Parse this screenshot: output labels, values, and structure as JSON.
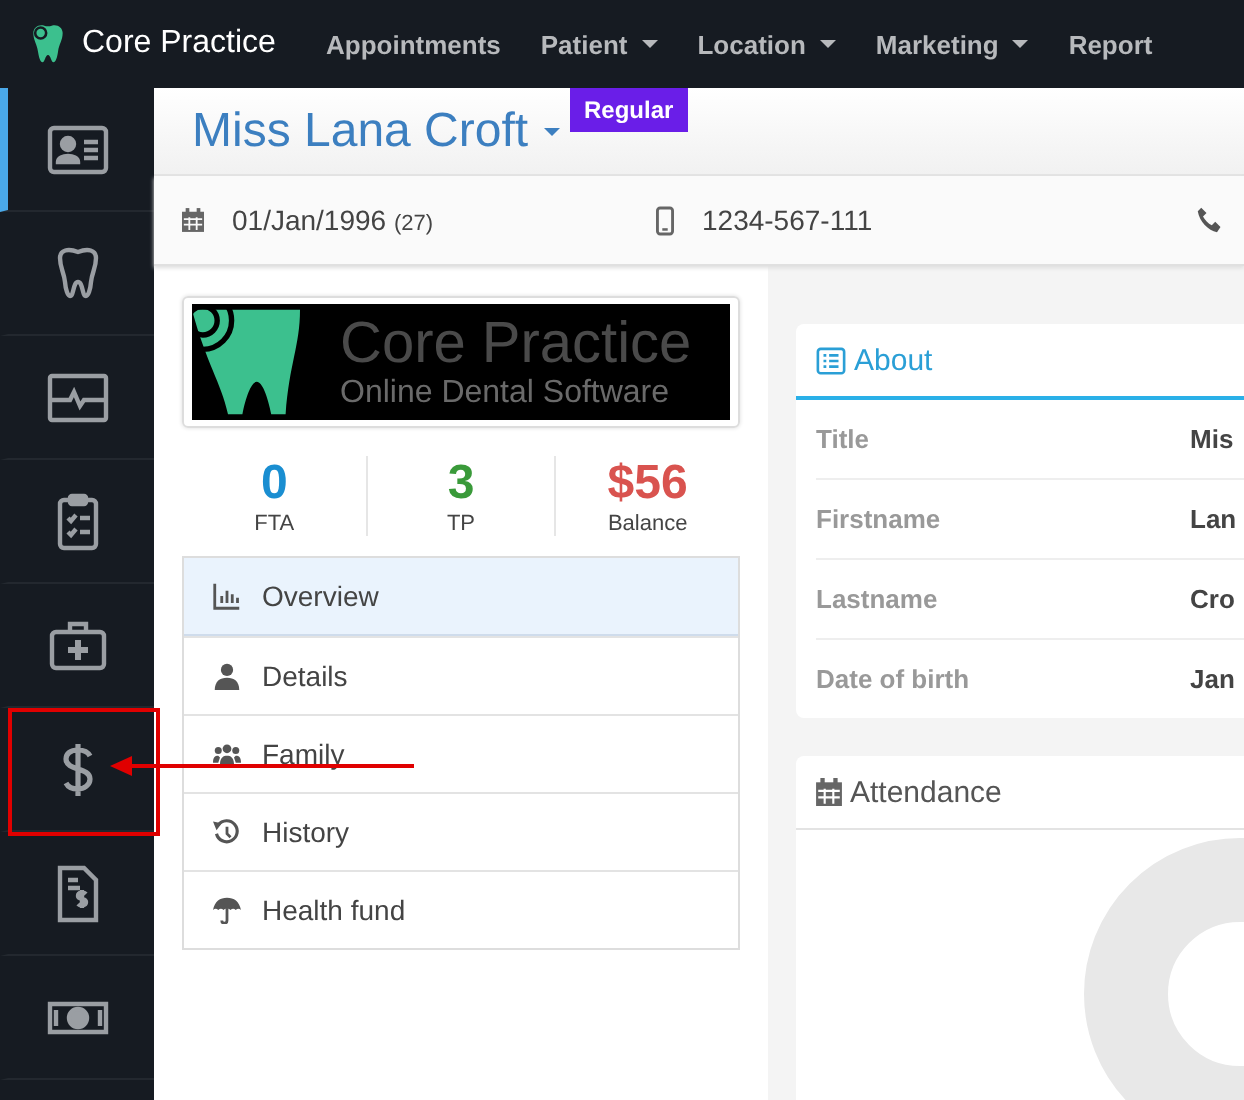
{
  "brand": {
    "name": "Core Practice"
  },
  "nav": [
    {
      "label": "Appointments",
      "dropdown": false
    },
    {
      "label": "Patient",
      "dropdown": true
    },
    {
      "label": "Location",
      "dropdown": true
    },
    {
      "label": "Marketing",
      "dropdown": true
    },
    {
      "label": "Report",
      "dropdown": false
    }
  ],
  "sidebar": {
    "items": [
      {
        "selected": true,
        "annotated": false
      },
      {
        "selected": false,
        "annotated": false
      },
      {
        "selected": false,
        "annotated": false
      },
      {
        "selected": false,
        "annotated": false
      },
      {
        "selected": false,
        "annotated": false
      },
      {
        "selected": false,
        "annotated": true
      },
      {
        "selected": false,
        "annotated": false
      },
      {
        "selected": false,
        "annotated": false
      }
    ]
  },
  "patient": {
    "name": "Miss Lana Croft",
    "badge": "Regular",
    "dob": "01/Jan/1996",
    "age": "(27)",
    "mobile": "1234-567-111"
  },
  "logo_card": {
    "title": "Core Practice",
    "subtitle": "Online Dental Software"
  },
  "stats": [
    {
      "value": "0",
      "label": "FTA",
      "color": "#1a8ed1"
    },
    {
      "value": "3",
      "label": "TP",
      "color": "#3a9a3a"
    },
    {
      "value": "$56",
      "label": "Balance",
      "color": "#d9534f"
    }
  ],
  "menu": [
    {
      "label": "Overview",
      "selected": true
    },
    {
      "label": "Details",
      "selected": false
    },
    {
      "label": "Family",
      "selected": false
    },
    {
      "label": "History",
      "selected": false
    },
    {
      "label": "Health fund",
      "selected": false
    }
  ],
  "about": {
    "title": "About",
    "rows": [
      {
        "label": "Title",
        "value": "Mis"
      },
      {
        "label": "Firstname",
        "value": "Lan"
      },
      {
        "label": "Lastname",
        "value": "Cro"
      },
      {
        "label": "Date of birth",
        "value": "Jan"
      }
    ]
  },
  "attendance": {
    "title": "Attendance"
  }
}
